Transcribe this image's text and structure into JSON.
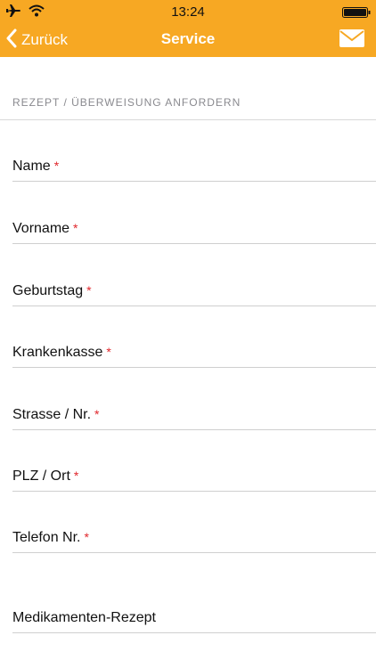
{
  "status_bar": {
    "time": "13:24"
  },
  "nav": {
    "back_label": "Zurück",
    "title": "Service"
  },
  "form": {
    "section_header": "REZEPT / ÜBERWEISUNG ANFORDERN",
    "required_marker": "*",
    "fields": [
      {
        "label": "Name"
      },
      {
        "label": "Vorname"
      },
      {
        "label": "Geburtstag"
      },
      {
        "label": "Krankenkasse"
      },
      {
        "label": "Strasse / Nr."
      },
      {
        "label": "PLZ / Ort"
      },
      {
        "label": "Telefon Nr."
      },
      {
        "label": "Medikamenten-Rezept"
      }
    ]
  },
  "icons": {
    "airplane": "airplane-icon",
    "wifi": "wifi-icon",
    "battery": "battery-icon",
    "back": "chevron-left-icon",
    "mail": "mail-icon"
  },
  "colors": {
    "accent": "#f7a823",
    "required": "#e0262b",
    "divider": "#cfcfcf",
    "section_header": "#8a8a8f"
  }
}
